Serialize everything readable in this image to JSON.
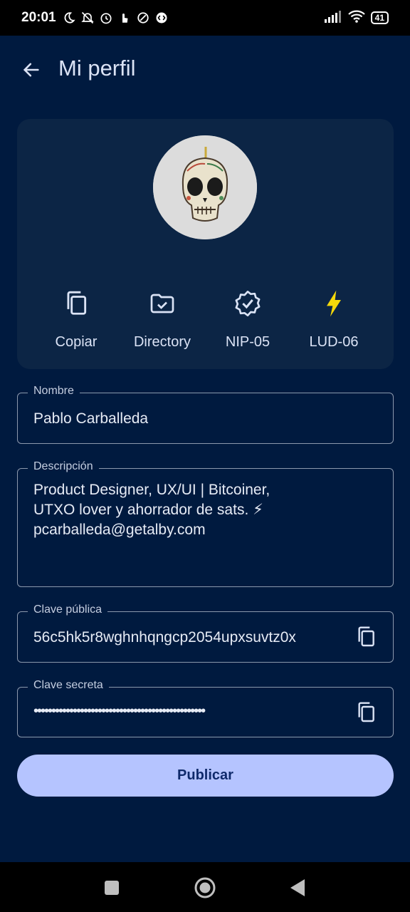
{
  "status_bar": {
    "time": "20:01",
    "battery": "41",
    "icons": [
      "moon-icon",
      "mute-icon",
      "alarm-icon",
      "hand-icon",
      "shield-icon",
      "shazam-icon"
    ],
    "right_icons": [
      "signal-icon",
      "wifi-icon",
      "battery-icon"
    ]
  },
  "header": {
    "title": "Mi perfil",
    "back_icon": "arrow-back-icon"
  },
  "profile": {
    "avatar_icon": "skull-avatar",
    "actions": [
      {
        "label": "Copiar",
        "icon": "copy-icon"
      },
      {
        "label": "Directory",
        "icon": "folder-check-icon"
      },
      {
        "label": "NIP-05",
        "icon": "verified-badge-icon"
      },
      {
        "label": "LUD-06",
        "icon": "lightning-icon"
      }
    ]
  },
  "form": {
    "name": {
      "label": "Nombre",
      "value": "Pablo Carballeda"
    },
    "description": {
      "label": "Descripción",
      "lines": [
        "Product Designer, UX/UI | Bitcoiner,",
        "UTXO lover y ahorrador de sats. ⚡",
        "pcarballeda@getalby.com"
      ]
    },
    "public_key": {
      "label": "Clave pública",
      "value": "56c5hk5r8wghnhqngcp2054upxsuvtz0x"
    },
    "secret_key": {
      "label": "Clave secreta",
      "value": "••••••••••••••••••••••••••••••••••••••••••••••••"
    }
  },
  "publish_label": "Publicar",
  "colors": {
    "background": "#001a3f",
    "card": "#0c2545",
    "accent_button": "#b5c4ff",
    "lightning": "#f5d90a"
  },
  "nav": [
    "recents-icon",
    "home-icon",
    "back-triangle-icon"
  ]
}
